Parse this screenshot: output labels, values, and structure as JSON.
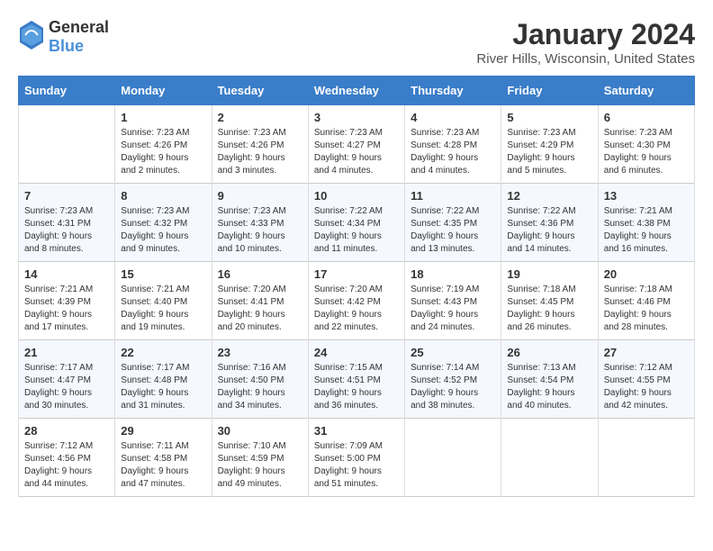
{
  "header": {
    "logo_general": "General",
    "logo_blue": "Blue",
    "month_year": "January 2024",
    "location": "River Hills, Wisconsin, United States"
  },
  "days_of_week": [
    "Sunday",
    "Monday",
    "Tuesday",
    "Wednesday",
    "Thursday",
    "Friday",
    "Saturday"
  ],
  "weeks": [
    [
      {
        "day": "",
        "sunrise": "",
        "sunset": "",
        "daylight": ""
      },
      {
        "day": "1",
        "sunrise": "Sunrise: 7:23 AM",
        "sunset": "Sunset: 4:26 PM",
        "daylight": "Daylight: 9 hours and 2 minutes."
      },
      {
        "day": "2",
        "sunrise": "Sunrise: 7:23 AM",
        "sunset": "Sunset: 4:26 PM",
        "daylight": "Daylight: 9 hours and 3 minutes."
      },
      {
        "day": "3",
        "sunrise": "Sunrise: 7:23 AM",
        "sunset": "Sunset: 4:27 PM",
        "daylight": "Daylight: 9 hours and 4 minutes."
      },
      {
        "day": "4",
        "sunrise": "Sunrise: 7:23 AM",
        "sunset": "Sunset: 4:28 PM",
        "daylight": "Daylight: 9 hours and 4 minutes."
      },
      {
        "day": "5",
        "sunrise": "Sunrise: 7:23 AM",
        "sunset": "Sunset: 4:29 PM",
        "daylight": "Daylight: 9 hours and 5 minutes."
      },
      {
        "day": "6",
        "sunrise": "Sunrise: 7:23 AM",
        "sunset": "Sunset: 4:30 PM",
        "daylight": "Daylight: 9 hours and 6 minutes."
      }
    ],
    [
      {
        "day": "7",
        "sunrise": "Sunrise: 7:23 AM",
        "sunset": "Sunset: 4:31 PM",
        "daylight": "Daylight: 9 hours and 8 minutes."
      },
      {
        "day": "8",
        "sunrise": "Sunrise: 7:23 AM",
        "sunset": "Sunset: 4:32 PM",
        "daylight": "Daylight: 9 hours and 9 minutes."
      },
      {
        "day": "9",
        "sunrise": "Sunrise: 7:23 AM",
        "sunset": "Sunset: 4:33 PM",
        "daylight": "Daylight: 9 hours and 10 minutes."
      },
      {
        "day": "10",
        "sunrise": "Sunrise: 7:22 AM",
        "sunset": "Sunset: 4:34 PM",
        "daylight": "Daylight: 9 hours and 11 minutes."
      },
      {
        "day": "11",
        "sunrise": "Sunrise: 7:22 AM",
        "sunset": "Sunset: 4:35 PM",
        "daylight": "Daylight: 9 hours and 13 minutes."
      },
      {
        "day": "12",
        "sunrise": "Sunrise: 7:22 AM",
        "sunset": "Sunset: 4:36 PM",
        "daylight": "Daylight: 9 hours and 14 minutes."
      },
      {
        "day": "13",
        "sunrise": "Sunrise: 7:21 AM",
        "sunset": "Sunset: 4:38 PM",
        "daylight": "Daylight: 9 hours and 16 minutes."
      }
    ],
    [
      {
        "day": "14",
        "sunrise": "Sunrise: 7:21 AM",
        "sunset": "Sunset: 4:39 PM",
        "daylight": "Daylight: 9 hours and 17 minutes."
      },
      {
        "day": "15",
        "sunrise": "Sunrise: 7:21 AM",
        "sunset": "Sunset: 4:40 PM",
        "daylight": "Daylight: 9 hours and 19 minutes."
      },
      {
        "day": "16",
        "sunrise": "Sunrise: 7:20 AM",
        "sunset": "Sunset: 4:41 PM",
        "daylight": "Daylight: 9 hours and 20 minutes."
      },
      {
        "day": "17",
        "sunrise": "Sunrise: 7:20 AM",
        "sunset": "Sunset: 4:42 PM",
        "daylight": "Daylight: 9 hours and 22 minutes."
      },
      {
        "day": "18",
        "sunrise": "Sunrise: 7:19 AM",
        "sunset": "Sunset: 4:43 PM",
        "daylight": "Daylight: 9 hours and 24 minutes."
      },
      {
        "day": "19",
        "sunrise": "Sunrise: 7:18 AM",
        "sunset": "Sunset: 4:45 PM",
        "daylight": "Daylight: 9 hours and 26 minutes."
      },
      {
        "day": "20",
        "sunrise": "Sunrise: 7:18 AM",
        "sunset": "Sunset: 4:46 PM",
        "daylight": "Daylight: 9 hours and 28 minutes."
      }
    ],
    [
      {
        "day": "21",
        "sunrise": "Sunrise: 7:17 AM",
        "sunset": "Sunset: 4:47 PM",
        "daylight": "Daylight: 9 hours and 30 minutes."
      },
      {
        "day": "22",
        "sunrise": "Sunrise: 7:17 AM",
        "sunset": "Sunset: 4:48 PM",
        "daylight": "Daylight: 9 hours and 31 minutes."
      },
      {
        "day": "23",
        "sunrise": "Sunrise: 7:16 AM",
        "sunset": "Sunset: 4:50 PM",
        "daylight": "Daylight: 9 hours and 34 minutes."
      },
      {
        "day": "24",
        "sunrise": "Sunrise: 7:15 AM",
        "sunset": "Sunset: 4:51 PM",
        "daylight": "Daylight: 9 hours and 36 minutes."
      },
      {
        "day": "25",
        "sunrise": "Sunrise: 7:14 AM",
        "sunset": "Sunset: 4:52 PM",
        "daylight": "Daylight: 9 hours and 38 minutes."
      },
      {
        "day": "26",
        "sunrise": "Sunrise: 7:13 AM",
        "sunset": "Sunset: 4:54 PM",
        "daylight": "Daylight: 9 hours and 40 minutes."
      },
      {
        "day": "27",
        "sunrise": "Sunrise: 7:12 AM",
        "sunset": "Sunset: 4:55 PM",
        "daylight": "Daylight: 9 hours and 42 minutes."
      }
    ],
    [
      {
        "day": "28",
        "sunrise": "Sunrise: 7:12 AM",
        "sunset": "Sunset: 4:56 PM",
        "daylight": "Daylight: 9 hours and 44 minutes."
      },
      {
        "day": "29",
        "sunrise": "Sunrise: 7:11 AM",
        "sunset": "Sunset: 4:58 PM",
        "daylight": "Daylight: 9 hours and 47 minutes."
      },
      {
        "day": "30",
        "sunrise": "Sunrise: 7:10 AM",
        "sunset": "Sunset: 4:59 PM",
        "daylight": "Daylight: 9 hours and 49 minutes."
      },
      {
        "day": "31",
        "sunrise": "Sunrise: 7:09 AM",
        "sunset": "Sunset: 5:00 PM",
        "daylight": "Daylight: 9 hours and 51 minutes."
      },
      {
        "day": "",
        "sunrise": "",
        "sunset": "",
        "daylight": ""
      },
      {
        "day": "",
        "sunrise": "",
        "sunset": "",
        "daylight": ""
      },
      {
        "day": "",
        "sunrise": "",
        "sunset": "",
        "daylight": ""
      }
    ]
  ]
}
